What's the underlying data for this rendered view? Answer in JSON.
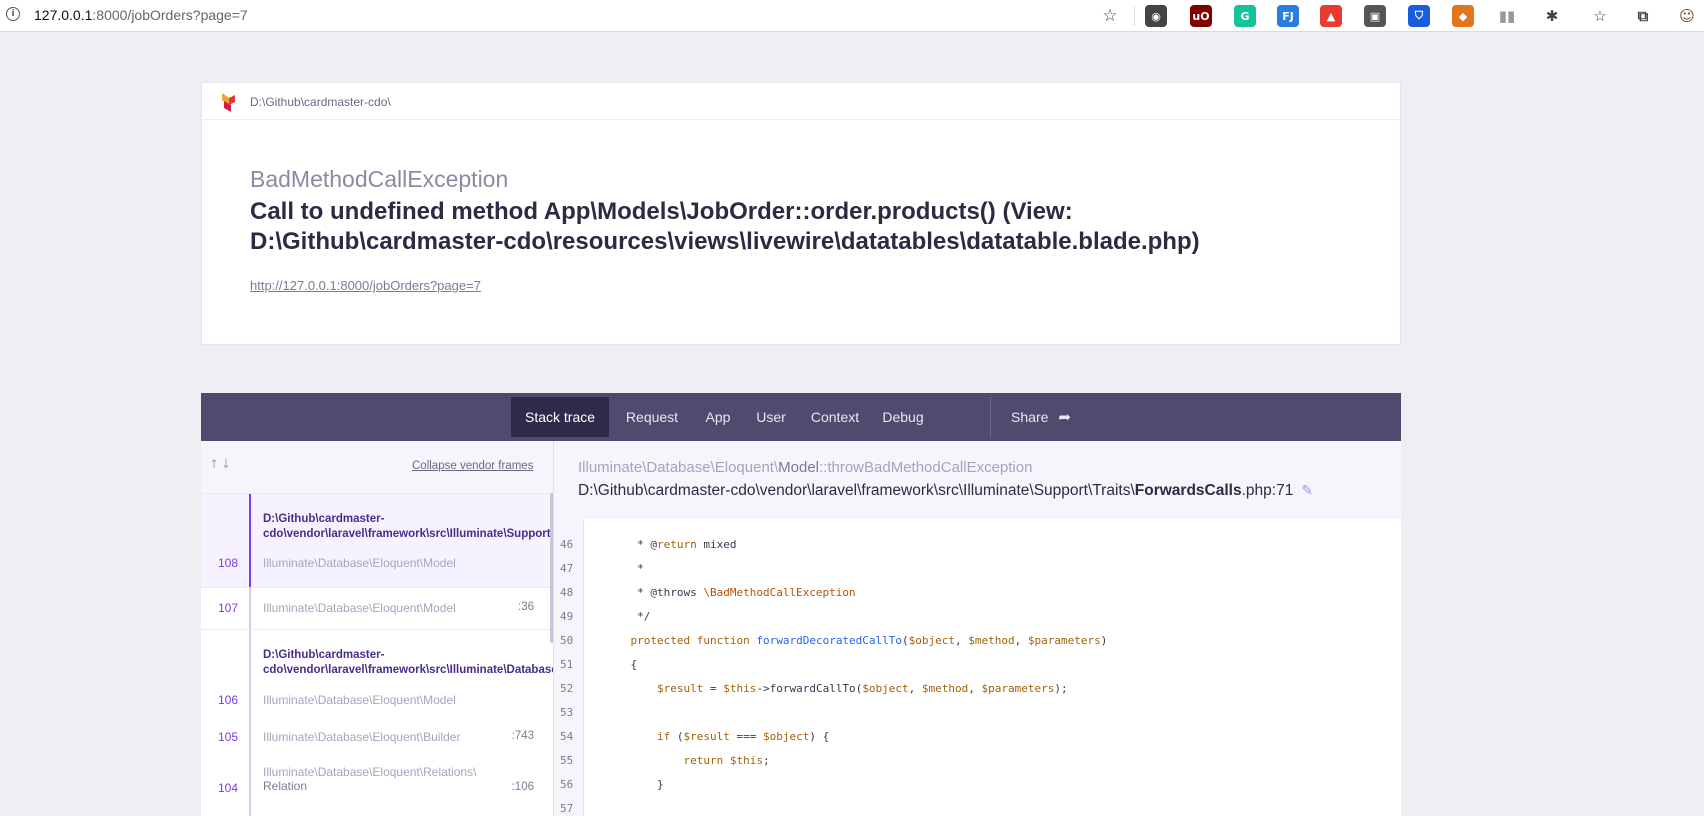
{
  "browser": {
    "url_host": "127.0.0.1",
    "url_rest": ":8000/jobOrders?page=7",
    "info_icon": "i",
    "extensions": [
      {
        "name": "extension-1",
        "glyph": "◉",
        "color": "#444444"
      },
      {
        "name": "ublock",
        "glyph": "uO",
        "color": "#800000"
      },
      {
        "name": "grammarly",
        "glyph": "G",
        "color": "#15c39a"
      },
      {
        "name": "extension-fj",
        "glyph": "FJ",
        "color": "#2a7de1"
      },
      {
        "name": "extension-red",
        "glyph": "▲",
        "color": "#e63b2e"
      },
      {
        "name": "extension-bag",
        "glyph": "▣",
        "color": "#555555"
      },
      {
        "name": "bitwarden",
        "glyph": "⛉",
        "color": "#175ddc"
      },
      {
        "name": "metamask",
        "glyph": "◆",
        "color": "#e2761b"
      },
      {
        "name": "reading-list",
        "glyph": "▮▮",
        "color": "#999999"
      },
      {
        "name": "puzzle",
        "glyph": "✱",
        "color": "#444444"
      },
      {
        "name": "favorites",
        "glyph": "☆",
        "color": "#444444"
      },
      {
        "name": "collections",
        "glyph": "⧉",
        "color": "#444444"
      },
      {
        "name": "profile",
        "glyph": "☺",
        "color": "#6b4f2a"
      }
    ]
  },
  "header": {
    "path": "D:\\Github\\cardmaster-cdo\\",
    "exception_class": "BadMethodCallException",
    "message": "Call to undefined method App\\Models\\JobOrder::order.products() (View: D:\\Github\\cardmaster-cdo\\resources\\views\\livewire\\datatables\\datatable.blade.php)",
    "url": "http://127.0.0.1:8000/jobOrders?page=7"
  },
  "tabs": [
    {
      "label": "Stack trace",
      "active": true
    },
    {
      "label": "Request"
    },
    {
      "label": "App"
    },
    {
      "label": "User"
    },
    {
      "label": "Context"
    },
    {
      "label": "Debug"
    }
  ],
  "share_label": "Share",
  "stack": {
    "arrows": "↑↓",
    "collapse_label": "Collapse vendor frames",
    "frames": [
      {
        "num": "108",
        "file": "D:\\Github\\cardmaster-cdo\\vendor\\laravel\\framework\\src\\Illuminate\\Support\\Traits\\ForwardsCalls.php",
        "file_line1": "D:\\Github\\cardmaster-",
        "file_line2": "cdo\\vendor\\laravel\\framework\\src\\Illuminate\\Support\\Traits",
        "class": "Illuminate\\Database\\Eloquent\\Model",
        "line": "",
        "selected": true
      },
      {
        "num": "107",
        "class": "Illuminate\\Database\\Eloquent\\Model",
        "line": ":36"
      },
      {
        "num": "106",
        "file_line1": "D:\\Github\\cardmaster-",
        "file_line2": "cdo\\vendor\\laravel\\framework\\src\\Illuminate\\Database\\Eloquent",
        "class": "Illuminate\\Database\\Eloquent\\Model",
        "line": ""
      },
      {
        "num": "105",
        "class": "Illuminate\\Database\\Eloquent\\Builder",
        "line": ":743"
      },
      {
        "num": "104",
        "class_line1": "Illuminate\\Database\\Eloquent\\Relations\\",
        "class_line2": "Relation",
        "line": ":106"
      }
    ]
  },
  "code": {
    "method_prefix": "Illuminate\\Database\\Eloquent\\",
    "method_class": "Model",
    "method_suffix": "::throwBadMethodCallException",
    "file_prefix": "D:\\Github\\cardmaster-cdo\\vendor\\laravel\\framework\\src\\Illuminate\\Support\\Traits\\",
    "file_name": "ForwardsCalls",
    "file_suffix": ".php:71",
    "lines": [
      {
        "n": "46",
        "text": "     * @return mixed"
      },
      {
        "n": "47",
        "text": "     *"
      },
      {
        "n": "48",
        "text": "     * @throws \\BadMethodCallException"
      },
      {
        "n": "49",
        "text": "     */"
      },
      {
        "n": "50",
        "text": "    protected function forwardDecoratedCallTo($object, $method, $parameters)"
      },
      {
        "n": "51",
        "text": "    {"
      },
      {
        "n": "52",
        "text": "        $result = $this->forwardCallTo($object, $method, $parameters);"
      },
      {
        "n": "53",
        "text": ""
      },
      {
        "n": "54",
        "text": "        if ($result === $object) {"
      },
      {
        "n": "55",
        "text": "            return $this;"
      },
      {
        "n": "56",
        "text": "        }"
      },
      {
        "n": "57",
        "text": ""
      }
    ]
  }
}
